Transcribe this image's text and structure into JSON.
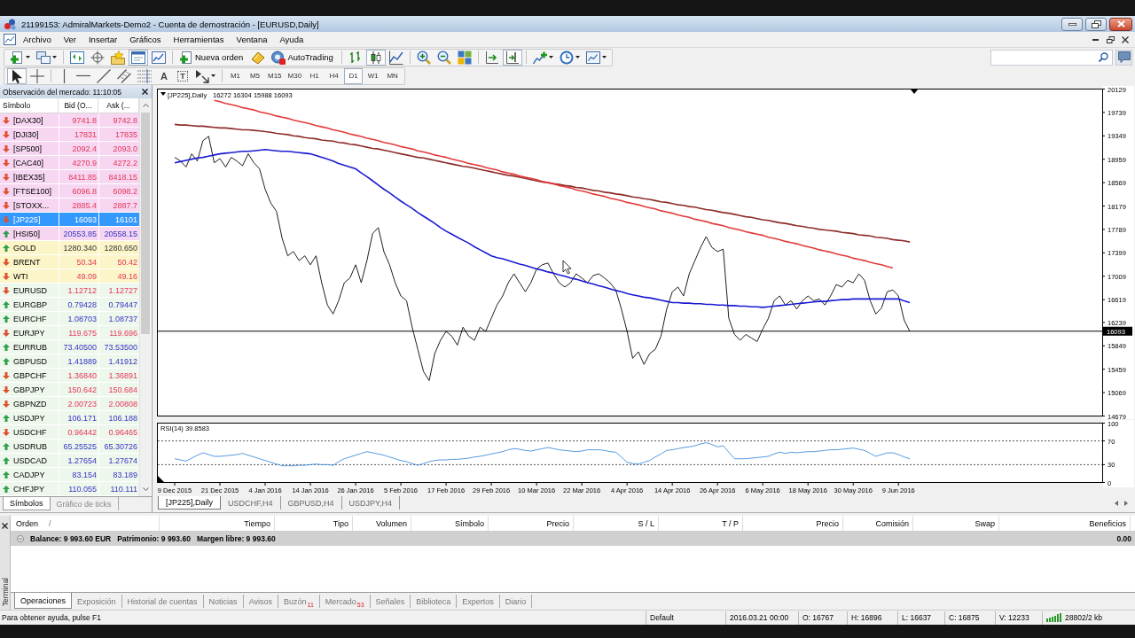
{
  "window": {
    "title": "21199153: AdmiralMarkets-Demo2 - Cuenta de demostración - [EURUSD,Daily]"
  },
  "menu": [
    "Archivo",
    "Ver",
    "Insertar",
    "Gráficos",
    "Herramientas",
    "Ventana",
    "Ayuda"
  ],
  "toolbar": {
    "groups": [
      [
        {
          "kind": "newchart",
          "pressed": false
        },
        {
          "kind": "profiles",
          "pressed": false
        }
      ],
      [
        {
          "kind": "marketwatch",
          "pressed": false
        },
        {
          "kind": "datawindow",
          "pressed": false
        },
        {
          "kind": "navigator",
          "pressed": false
        },
        {
          "kind": "terminal",
          "pressed": true
        },
        {
          "kind": "tester",
          "pressed": false
        }
      ],
      [
        {
          "kind": "order",
          "label": "Nueva orden",
          "pressed": false
        },
        {
          "kind": "editor",
          "pressed": false
        },
        {
          "kind": "autotrading",
          "label": "AutoTrading",
          "pressed": false
        }
      ],
      [
        {
          "kind": "bars",
          "pressed": false
        },
        {
          "kind": "candles",
          "pressed": true
        },
        {
          "kind": "line",
          "pressed": false
        }
      ],
      [
        {
          "kind": "zoomin",
          "pressed": false
        },
        {
          "kind": "zoomout",
          "pressed": false
        },
        {
          "kind": "tile",
          "pressed": false
        }
      ],
      [
        {
          "kind": "autoscroll",
          "pressed": false
        },
        {
          "kind": "shift",
          "pressed": true
        }
      ],
      [
        {
          "kind": "indicators",
          "pressed": false
        },
        {
          "kind": "periods",
          "pressed": false
        },
        {
          "kind": "templates",
          "pressed": false
        }
      ]
    ]
  },
  "drawing_toolbar": {
    "groups": [
      [
        {
          "kind": "cursor",
          "pressed": true
        },
        {
          "kind": "crosshair",
          "pressed": false
        }
      ],
      [
        {
          "kind": "vline",
          "pressed": false
        },
        {
          "kind": "hline",
          "pressed": false
        },
        {
          "kind": "trendline",
          "pressed": false
        },
        {
          "kind": "channel",
          "pressed": false
        },
        {
          "kind": "fibonacci",
          "pressed": false
        },
        {
          "kind": "text",
          "glyph": "A",
          "pressed": false
        },
        {
          "kind": "label",
          "glyph": "T",
          "pressed": false
        },
        {
          "kind": "shapes",
          "pressed": false
        }
      ]
    ],
    "timeframes": [
      {
        "label": "M1",
        "selected": false
      },
      {
        "label": "M5",
        "selected": false
      },
      {
        "label": "M15",
        "selected": false
      },
      {
        "label": "M30",
        "selected": false
      },
      {
        "label": "H1",
        "selected": false
      },
      {
        "label": "H4",
        "selected": false
      },
      {
        "label": "D1",
        "selected": true
      },
      {
        "label": "W1",
        "selected": false
      },
      {
        "label": "MN",
        "selected": false
      }
    ]
  },
  "market_watch": {
    "title": "Observación del mercado: 11:10:05",
    "columns": [
      "Símbolo",
      "Bid (O...",
      "Ask (..."
    ],
    "rows": [
      {
        "symbol": "[DAX30]",
        "bid": "9741.8",
        "ask": "9742.8",
        "rising": false,
        "changed": true,
        "color": "#f6d6f0",
        "selected": false
      },
      {
        "symbol": "[DJI30]",
        "bid": "17831",
        "ask": "17835",
        "rising": false,
        "changed": true,
        "color": "#f6d6f0",
        "selected": false
      },
      {
        "symbol": "[SP500]",
        "bid": "2092.4",
        "ask": "2093.0",
        "rising": false,
        "changed": true,
        "color": "#f6d6f0",
        "selected": false
      },
      {
        "symbol": "[CAC40]",
        "bid": "4270.9",
        "ask": "4272.2",
        "rising": false,
        "changed": true,
        "color": "#f6d6f0",
        "selected": false
      },
      {
        "symbol": "[IBEX35]",
        "bid": "8411.85",
        "ask": "8418.15",
        "rising": false,
        "changed": true,
        "color": "#f6d6f0",
        "selected": false
      },
      {
        "symbol": "[FTSE100]",
        "bid": "6096.8",
        "ask": "6098.2",
        "rising": false,
        "changed": true,
        "color": "#f6d6f0",
        "selected": false
      },
      {
        "symbol": "[STOXX...",
        "bid": "2885.4",
        "ask": "2887.7",
        "rising": false,
        "changed": true,
        "color": "#f6d6f0",
        "selected": false
      },
      {
        "symbol": "[JP225]",
        "bid": "16093",
        "ask": "16101",
        "rising": false,
        "changed": true,
        "selected": true
      },
      {
        "symbol": "[HSI50]",
        "bid": "20553.85",
        "ask": "20558.15",
        "rising": true,
        "changed": true,
        "color": "#f6d6f0",
        "selected": false
      },
      {
        "symbol": "GOLD",
        "bid": "1280.340",
        "ask": "1280.650",
        "rising": true,
        "changed": false,
        "color": "#fbf5c8",
        "selected": false
      },
      {
        "symbol": "BRENT",
        "bid": "50.34",
        "ask": "50.42",
        "rising": false,
        "changed": true,
        "color": "#fbf5c8",
        "selected": false
      },
      {
        "symbol": "WTI",
        "bid": "49.09",
        "ask": "49.16",
        "rising": false,
        "changed": true,
        "color": "#fbf5c8",
        "selected": false
      },
      {
        "symbol": "EURUSD",
        "bid": "1.12712",
        "ask": "1.12727",
        "rising": false,
        "changed": true,
        "color": "#eef7ec",
        "selected": false
      },
      {
        "symbol": "EURGBP",
        "bid": "0.79428",
        "ask": "0.79447",
        "rising": true,
        "changed": true,
        "color": "#eef7ec",
        "selected": false
      },
      {
        "symbol": "EURCHF",
        "bid": "1.08703",
        "ask": "1.08737",
        "rising": true,
        "changed": true,
        "color": "#eef7ec",
        "selected": false
      },
      {
        "symbol": "EURJPY",
        "bid": "119.675",
        "ask": "119.696",
        "rising": false,
        "changed": true,
        "color": "#eef7ec",
        "selected": false
      },
      {
        "symbol": "EURRUB",
        "bid": "73.40500",
        "ask": "73.53500",
        "rising": true,
        "changed": true,
        "color": "#eef7ec",
        "selected": false
      },
      {
        "symbol": "GBPUSD",
        "bid": "1.41889",
        "ask": "1.41912",
        "rising": true,
        "changed": true,
        "color": "#eef7ec",
        "selected": false
      },
      {
        "symbol": "GBPCHF",
        "bid": "1.36840",
        "ask": "1.36891",
        "rising": false,
        "changed": true,
        "color": "#eef7ec",
        "selected": false
      },
      {
        "symbol": "GBPJPY",
        "bid": "150.642",
        "ask": "150.684",
        "rising": false,
        "changed": true,
        "color": "#eef7ec",
        "selected": false
      },
      {
        "symbol": "GBPNZD",
        "bid": "2.00723",
        "ask": "2.00808",
        "rising": false,
        "changed": true,
        "color": "#eef7ec",
        "selected": false
      },
      {
        "symbol": "USDJPY",
        "bid": "106.171",
        "ask": "106.188",
        "rising": true,
        "changed": true,
        "color": "#eef7ec",
        "selected": false
      },
      {
        "symbol": "USDCHF",
        "bid": "0.96442",
        "ask": "0.96465",
        "rising": false,
        "changed": true,
        "color": "#eef7ec",
        "selected": false
      },
      {
        "symbol": "USDRUB",
        "bid": "65.25525",
        "ask": "65.30726",
        "rising": true,
        "changed": true,
        "color": "#eef7ec",
        "selected": false
      },
      {
        "symbol": "USDCAD",
        "bid": "1.27654",
        "ask": "1.27674",
        "rising": true,
        "changed": true,
        "color": "#eef7ec",
        "selected": false
      },
      {
        "symbol": "CADJPY",
        "bid": "83.154",
        "ask": "83.189",
        "rising": true,
        "changed": true,
        "color": "#eef7ec",
        "selected": false
      },
      {
        "symbol": "CHFJPY",
        "bid": "110.055",
        "ask": "110.111",
        "rising": true,
        "changed": true,
        "color": "#eef7ec",
        "selected": false
      }
    ],
    "tabs": [
      {
        "label": "Símbolos",
        "selected": true
      },
      {
        "label": "Gráfico de ticks",
        "selected": false
      }
    ]
  },
  "chart": {
    "header_values": "16272 16304 15988 16093",
    "price_chart": {
      "chart_data": {
        "type": "line",
        "title": "[JP225],Daily",
        "categories": [
          null,
          null,
          null,
          null,
          null,
          null,
          null,
          null,
          null,
          null,
          null,
          null,
          null,
          null,
          null,
          null,
          null,
          null,
          null,
          null,
          null,
          null,
          null,
          null,
          null,
          null,
          null,
          null,
          null,
          null,
          null,
          null,
          null,
          null,
          null,
          null,
          null,
          null,
          null,
          null,
          null,
          null,
          null,
          null,
          null,
          null,
          null,
          null,
          null,
          null,
          null,
          null,
          null,
          null,
          null,
          null,
          null,
          null,
          null,
          null,
          null,
          null,
          null,
          null,
          null,
          null,
          null,
          null,
          null,
          null,
          null,
          null,
          null,
          null,
          null,
          null,
          null,
          null,
          null,
          null,
          null,
          null,
          null,
          null,
          null,
          null,
          null,
          null,
          null,
          null,
          null,
          null,
          null,
          null,
          null,
          null,
          null,
          null,
          null,
          null,
          null,
          null,
          null,
          null,
          null,
          null,
          null,
          null,
          null,
          null,
          null,
          null,
          null,
          null,
          null,
          null,
          null,
          null,
          null,
          null,
          null,
          null,
          null,
          null,
          null,
          null,
          null,
          null,
          null,
          null,
          null
        ],
        "ylim": [
          14679,
          20129
        ],
        "yticks": [
          20129,
          19739,
          19349,
          18959,
          18569,
          18179,
          17789,
          17399,
          17009,
          16619,
          16239,
          15849,
          15459,
          15069,
          14679
        ],
        "series": [
          {
            "color": "#1e1e1e",
            "values": [
              18990,
              18930,
              18830,
              19050,
              18930,
              19270,
              19340,
              18900,
              18970,
              18830,
              18990,
              18930,
              18850,
              19050,
              18900,
              18800,
              18460,
              18230,
              18090,
              17640,
              17350,
              17420,
              17270,
              17350,
              17200,
              17350,
              16900,
              16530,
              16380,
              16600,
              16900,
              16980,
              17200,
              16900,
              17270,
              17720,
              17820,
              17420,
              17200,
              16900,
              16680,
              16600,
              16160,
              15790,
              15420,
              15270,
              15720,
              15940,
              16090,
              16010,
              15860,
              16160,
              16010,
              15940,
              16160,
              16090,
              16310,
              16530,
              16680,
              16900,
              17050,
              16900,
              16750,
              16900,
              17130,
              17200,
              17230,
              17050,
              16900,
              16830,
              16900,
              17050,
              16980,
              16900,
              17020,
              17050,
              16980,
              16900,
              16780,
              16460,
              16090,
              15640,
              15750,
              15540,
              15720,
              15790,
              16010,
              16460,
              16750,
              16830,
              16680,
              17050,
              17270,
              17490,
              17670,
              17490,
              17420,
              17460,
              16310,
              16040,
              15940,
              16040,
              15980,
              15920,
              16130,
              16310,
              16600,
              16680,
              16530,
              16600,
              16460,
              16600,
              16680,
              16600,
              16630,
              16530,
              16680,
              16870,
              16830,
              16940,
              16900,
              17050,
              16940,
              16600,
              16380,
              16480,
              16750,
              16780,
              16680,
              16280,
              16090
            ]
          },
          {
            "color": "#1a1ad2",
            "values": [
              18900,
              18920,
              18940,
              18960,
              18980,
              18990,
              19010,
              19030,
              19050,
              19060,
              19070,
              19080,
              19090,
              19090,
              19100,
              19110,
              19120,
              19110,
              19100,
              19090,
              19090,
              19080,
              19070,
              19060,
              19050,
              19020,
              18990,
              18960,
              18930,
              18890,
              18860,
              18830,
              18800,
              18730,
              18670,
              18600,
              18530,
              18460,
              18400,
              18330,
              18260,
              18200,
              18140,
              18070,
              18010,
              17950,
              17890,
              17820,
              17760,
              17710,
              17660,
              17610,
              17560,
              17500,
              17450,
              17400,
              17350,
              17320,
              17300,
              17270,
              17240,
              17210,
              17190,
              17160,
              17130,
              17110,
              17080,
              17060,
              17030,
              17010,
              16980,
              16960,
              16930,
              16900,
              16880,
              16850,
              16830,
              16800,
              16770,
              16750,
              16720,
              16700,
              16680,
              16660,
              16650,
              16630,
              16610,
              16590,
              16570,
              16570,
              16560,
              16560,
              16550,
              16550,
              16540,
              16540,
              16530,
              16530,
              16520,
              16520,
              16510,
              16510,
              16500,
              16500,
              16490,
              16500,
              16510,
              16520,
              16530,
              16540,
              16550,
              16560,
              16570,
              16580,
              16590,
              16590,
              16600,
              16610,
              16620,
              16620,
              16630,
              16630,
              16630,
              16630,
              16630,
              16630,
              16630,
              16630,
              16630,
              16600,
              16570
            ]
          },
          {
            "color": "#8c2c28",
            "values": [
              19540,
              19530,
              19530,
              19520,
              19510,
              19510,
              19500,
              19490,
              19480,
              19480,
              19470,
              19460,
              19450,
              19450,
              19440,
              19430,
              19420,
              19410,
              19390,
              19380,
              19370,
              19350,
              19340,
              19320,
              19310,
              19300,
              19280,
              19270,
              19260,
              19240,
              19230,
              19210,
              19200,
              19180,
              19160,
              19140,
              19130,
              19110,
              19090,
              19070,
              19050,
              19030,
              19010,
              18990,
              18980,
              18960,
              18940,
              18920,
              18900,
              18880,
              18860,
              18840,
              18830,
              18810,
              18790,
              18770,
              18750,
              18730,
              18710,
              18690,
              18680,
              18660,
              18640,
              18620,
              18600,
              18580,
              18570,
              18550,
              18540,
              18520,
              18510,
              18490,
              18480,
              18460,
              18440,
              18430,
              18410,
              18400,
              18380,
              18370,
              18350,
              18330,
              18320,
              18300,
              18290,
              18270,
              18250,
              18240,
              18220,
              18200,
              18190,
              18170,
              18160,
              18140,
              18120,
              18110,
              18090,
              18070,
              18060,
              18040,
              18020,
              18000,
              17990,
              17970,
              17950,
              17940,
              17920,
              17900,
              17890,
              17870,
              17850,
              17840,
              17820,
              17810,
              17790,
              17780,
              17770,
              17760,
              17740,
              17730,
              17720,
              17700,
              17690,
              17680,
              17660,
              17650,
              17640,
              17620,
              17610,
              17600,
              17580
            ]
          },
          {
            "color": "#e23a3a",
            "values": [
              null,
              null,
              null,
              null,
              null,
              null,
              null,
              19940,
              19920,
              19890,
              19870,
              19850,
              19820,
              19800,
              19780,
              19750,
              19730,
              19710,
              19680,
              19660,
              19640,
              19610,
              19590,
              19570,
              19550,
              19520,
              19500,
              19480,
              19450,
              19430,
              19410,
              19380,
              19360,
              19340,
              19310,
              19290,
              19270,
              19240,
              19220,
              19200,
              19170,
              19150,
              19130,
              19100,
              19080,
              19060,
              19030,
              19010,
              18990,
              18960,
              18940,
              18920,
              18890,
              18870,
              18850,
              18820,
              18800,
              18780,
              18750,
              18730,
              18710,
              18680,
              18660,
              18640,
              18620,
              18590,
              18570,
              18550,
              18520,
              18500,
              18480,
              18450,
              18430,
              18410,
              18380,
              18360,
              18340,
              18310,
              18290,
              18270,
              18240,
              18220,
              18200,
              18170,
              18150,
              18130,
              18100,
              18080,
              18060,
              18030,
              18010,
              17990,
              17960,
              17940,
              17920,
              17890,
              17870,
              17850,
              17820,
              17800,
              17780,
              17750,
              17730,
              17710,
              17690,
              17660,
              17640,
              17620,
              17590,
              17570,
              17550,
              17520,
              17500,
              17480,
              17450,
              17430,
              17410,
              17380,
              17360,
              17340,
              17310,
              17290,
              17270,
              17240,
              17220,
              17200,
              17170,
              17150,
              null,
              null,
              null
            ]
          }
        ],
        "ref_lines": [
          {
            "axis": "y",
            "value": 16093,
            "label": "16093",
            "color": "#000000"
          }
        ]
      }
    },
    "rsi_chart": {
      "chart_data": {
        "type": "line",
        "title": "RSI(14) 39.8583",
        "categories": [
          "9 Dec 2015",
          null,
          null,
          null,
          null,
          null,
          null,
          null,
          "21 Dec 2015",
          null,
          null,
          null,
          null,
          null,
          null,
          null,
          "4 Jan 2016",
          null,
          null,
          null,
          null,
          null,
          null,
          null,
          "14 Jan 2016",
          null,
          null,
          null,
          null,
          null,
          null,
          null,
          "26 Jan 2016",
          null,
          null,
          null,
          null,
          null,
          null,
          null,
          "5 Feb 2016",
          null,
          null,
          null,
          null,
          null,
          null,
          null,
          "17 Feb 2016",
          null,
          null,
          null,
          null,
          null,
          null,
          null,
          "29 Feb 2016",
          null,
          null,
          null,
          null,
          null,
          null,
          null,
          "10 Mar 2016",
          null,
          null,
          null,
          null,
          null,
          null,
          null,
          "22 Mar 2016",
          null,
          null,
          null,
          null,
          null,
          null,
          null,
          "4 Apr 2016",
          null,
          null,
          null,
          null,
          null,
          null,
          null,
          "14 Apr 2016",
          null,
          null,
          null,
          null,
          null,
          null,
          null,
          "26 Apr 2016",
          null,
          null,
          null,
          null,
          null,
          null,
          null,
          "6 May 2016",
          null,
          null,
          null,
          null,
          null,
          null,
          null,
          "18 May 2016",
          null,
          null,
          null,
          null,
          null,
          null,
          null,
          "30 May 2016",
          null,
          null,
          null,
          null,
          null,
          null,
          null,
          "9 Jun 2016",
          null,
          null
        ],
        "ylim": [
          0,
          100
        ],
        "yticks": [
          100,
          70,
          30,
          0
        ],
        "series": [
          {
            "color": "#3f8fdc",
            "values": [
              40,
              38,
              36,
              41,
              46,
              50,
              47,
              44,
              44,
              45,
              46,
              47,
              49,
              46,
              43,
              40,
              37,
              34,
              31,
              28,
              28,
              28,
              29,
              29,
              30,
              31,
              30,
              30,
              29,
              35,
              40,
              43,
              46,
              49,
              52,
              50,
              48,
              46,
              43,
              40,
              37,
              35,
              32,
              29,
              32,
              35,
              37,
              38,
              38,
              39,
              39,
              40,
              41,
              43,
              44,
              46,
              48,
              50,
              52,
              55,
              57,
              56,
              54,
              53,
              55,
              57,
              59,
              57,
              55,
              54,
              53,
              52,
              53,
              55,
              55,
              55,
              54,
              52,
              51,
              43,
              34,
              32,
              31,
              34,
              37,
              43,
              48,
              54,
              55,
              57,
              59,
              60,
              62,
              65,
              67,
              64,
              60,
              62,
              51,
              40,
              40,
              40,
              41,
              42,
              43,
              44,
              48,
              51,
              49,
              51,
              50,
              51,
              52,
              52,
              53,
              54,
              55,
              55,
              56,
              57,
              58,
              56,
              54,
              49,
              44,
              47,
              50,
              50,
              47,
              43,
              40
            ]
          }
        ],
        "ref_lines": [
          {
            "axis": "y",
            "value": 70,
            "color": "#555555"
          },
          {
            "axis": "y",
            "value": 30,
            "color": "#555555"
          }
        ]
      }
    },
    "tabs": [
      {
        "label": "[JP225],Daily",
        "selected": true
      },
      {
        "label": "USDCHF,H4",
        "selected": false
      },
      {
        "label": "GBPUSD,H4",
        "selected": false
      },
      {
        "label": "USDJPY,H4",
        "selected": false
      }
    ]
  },
  "terminal": {
    "label": "Terminal",
    "columns": [
      {
        "label": "Orden",
        "sort_mark": "/"
      },
      {
        "label": "Tiempo"
      },
      {
        "label": "Tipo"
      },
      {
        "label": "Volumen"
      },
      {
        "label": "Símbolo"
      },
      {
        "label": "Precio"
      },
      {
        "label": "S / L"
      },
      {
        "label": "T / P"
      },
      {
        "label": "Precio"
      },
      {
        "label": "Comisión"
      },
      {
        "label": "Swap"
      },
      {
        "label": "Beneficios"
      }
    ],
    "balance": {
      "items": [
        "Balance: 9 993.60 EUR",
        "Patrimonio: 9 993.60",
        "Margen libre: 9 993.60"
      ],
      "profit": "0.00"
    },
    "tabs": [
      {
        "label": "Operaciones",
        "selected": true
      },
      {
        "label": "Exposición",
        "selected": false
      },
      {
        "label": "Historial de cuentas",
        "selected": false
      },
      {
        "label": "Noticias",
        "selected": false
      },
      {
        "label": "Avisos",
        "selected": false
      },
      {
        "label": "Buzón",
        "count": "11",
        "selected": false
      },
      {
        "label": "Mercado",
        "count": "53",
        "selected": false
      },
      {
        "label": "Señales",
        "selected": false
      },
      {
        "label": "Biblioteca",
        "selected": false
      },
      {
        "label": "Expertos",
        "selected": false
      },
      {
        "label": "Diario",
        "selected": false
      }
    ]
  },
  "status_bar": {
    "help": "Para obtener ayuda, pulse F1",
    "fields": [
      "Default",
      "2016.03.21 00:00",
      "O: 16767",
      "H: 16896",
      "L: 16637",
      "C: 16875",
      "V: 12233"
    ],
    "connection": "28802/2 kb"
  }
}
